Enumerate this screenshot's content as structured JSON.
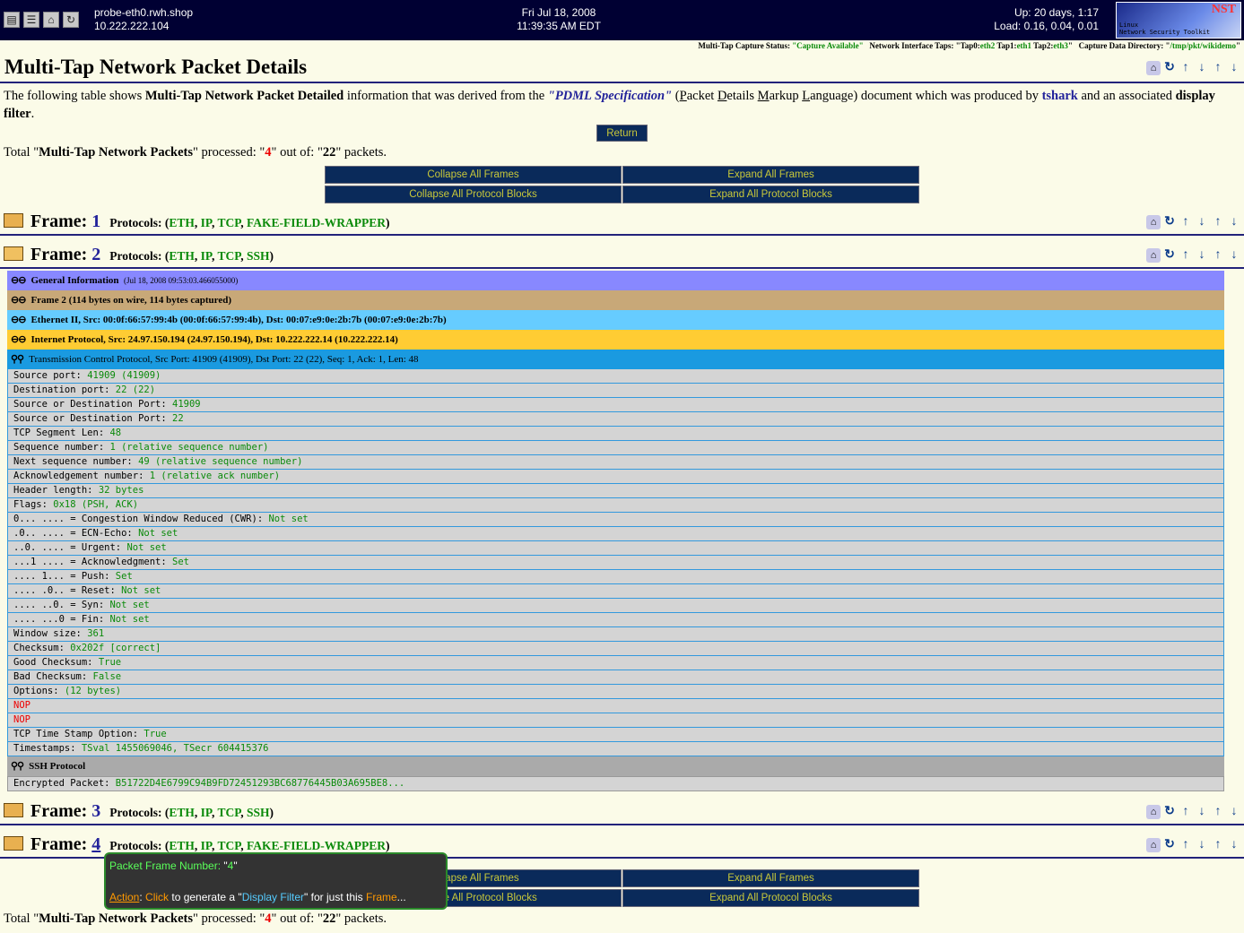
{
  "topbar": {
    "host": "probe-eth0.rwh.shop",
    "ip": "10.222.222.104",
    "date": "Fri Jul 18, 2008",
    "time": "11:39:35 AM EDT",
    "uptime": "Up: 20 days, 1:17",
    "load": "Load: 0.16, 0.04, 0.01",
    "logo": "NST",
    "logo_sub1": "Linux",
    "logo_sub2": "Network Security Toolkit"
  },
  "status": {
    "capture_label": "Multi-Tap Capture Status:",
    "capture_value": "\"Capture Available\"",
    "taps_label": "Network Interface Taps: \"Tap0:",
    "tap0": "eth2",
    "tap1_label": " Tap1:",
    "tap1": "eth1",
    "tap2_label": " Tap2:",
    "tap2": "eth3",
    "taps_end": "\"",
    "dir_label": "Capture Data Directory: \"",
    "dir": "/tmp/pkt/wikidemo",
    "dir_end": "\""
  },
  "page_title": "Multi-Tap Network Packet Details",
  "intro": {
    "p1": "The following table shows ",
    "b1": "Multi-Tap Network Packet Detailed",
    "p2": " information that was derived from the ",
    "pdml": "\"PDML Specification\"",
    "p3": " (",
    "P": "P",
    "acket": "acket ",
    "D": "D",
    "etails": "etails ",
    "M": "M",
    "arkup": "arkup ",
    "L": "L",
    "anguage": "anguage",
    "p4": ") document which was produced by ",
    "tshark": "tshark",
    "p5": " and an associated ",
    "b2": "display filter",
    "p6": "."
  },
  "return_label": "Return",
  "totals": {
    "pre": "Total \"",
    "b": "Multi-Tap Network Packets",
    "mid": "\" processed: \"",
    "n": "4",
    "mid2": "\" out of: \"",
    "total": "22",
    "end": "\" packets."
  },
  "buttons": {
    "collapse_frames": "Collapse All Frames",
    "expand_frames": "Expand All Frames",
    "collapse_blocks": "Collapse All Protocol Blocks",
    "expand_blocks": "Expand All Protocol Blocks"
  },
  "frames": [
    {
      "label": "Frame:",
      "num": "1",
      "proto_label": "Protocols:",
      "protos": [
        "ETH",
        "IP",
        "TCP",
        "FAKE-FIELD-WRAPPER"
      ]
    },
    {
      "label": "Frame:",
      "num": "2",
      "proto_label": "Protocols:",
      "protos": [
        "ETH",
        "IP",
        "TCP",
        "SSH"
      ]
    },
    {
      "label": "Frame:",
      "num": "3",
      "proto_label": "Protocols:",
      "protos": [
        "ETH",
        "IP",
        "TCP",
        "SSH"
      ]
    },
    {
      "label": "Frame:",
      "num": "4",
      "proto_label": "Protocols:",
      "protos": [
        "ETH",
        "IP",
        "TCP",
        "FAKE-FIELD-WRAPPER"
      ]
    }
  ],
  "blocks": {
    "general": "General Information",
    "general_ts": "(Jul 18, 2008 09:53:03.466055000)",
    "frame": "Frame 2 (114 bytes on wire, 114 bytes captured)",
    "eth": "Ethernet II, Src: 00:0f:66:57:99:4b (00:0f:66:57:99:4b), Dst: 00:07:e9:0e:2b:7b (00:07:e9:0e:2b:7b)",
    "ip": "Internet Protocol, Src: 24.97.150.194 (24.97.150.194), Dst: 10.222.222.14 (10.222.222.14)",
    "tcp": "Transmission Control Protocol, Src Port: 41909 (41909), Dst Port: 22 (22), Seq: 1, Ack: 1, Len: 48",
    "ssh": "SSH Protocol"
  },
  "tcp_fields": [
    [
      "Source port: ",
      "41909 (41909)"
    ],
    [
      "Destination port: ",
      "22 (22)"
    ],
    [
      "Source or Destination Port: ",
      "41909"
    ],
    [
      "Source or Destination Port: ",
      "22"
    ],
    [
      "TCP Segment Len: ",
      "48"
    ],
    [
      "Sequence number: ",
      "1 (relative sequence number)"
    ],
    [
      "Next sequence number: ",
      "49 (relative sequence number)"
    ],
    [
      "Acknowledgement number: ",
      "1 (relative ack number)"
    ],
    [
      "Header length: ",
      "32 bytes"
    ],
    [
      "Flags: ",
      "0x18 (PSH, ACK)"
    ],
    [
      "0... .... = Congestion Window Reduced (CWR): ",
      "Not set"
    ],
    [
      ".0.. .... = ECN-Echo: ",
      "Not set"
    ],
    [
      "..0. .... = Urgent: ",
      "Not set"
    ],
    [
      "...1 .... = Acknowledgment: ",
      "Set"
    ],
    [
      ".... 1... = Push: ",
      "Set"
    ],
    [
      ".... .0.. = Reset: ",
      "Not set"
    ],
    [
      ".... ..0. = Syn: ",
      "Not set"
    ],
    [
      ".... ...0 = Fin: ",
      "Not set"
    ],
    [
      "Window size: ",
      "361"
    ],
    [
      "Checksum: ",
      "0x202f [correct]"
    ],
    [
      "Good Checksum: ",
      "True"
    ],
    [
      "Bad Checksum: ",
      "False"
    ],
    [
      "Options: ",
      "(12 bytes)"
    ],
    [
      "",
      "NOP"
    ],
    [
      "",
      "NOP"
    ],
    [
      "TCP Time Stamp Option: ",
      "True"
    ],
    [
      "Timestamps: ",
      "TSval 1455069046, TSecr 604415376"
    ]
  ],
  "ssh_field": [
    "Encrypted Packet: ",
    "B51722D4E6799C94B9FD72451293BC68776445B03A695BE8..."
  ],
  "tooltip": {
    "t1": "Packet Frame Number: ",
    "q1": "\"",
    "num": "4",
    "q2": "\"",
    "action": "Action",
    "colon": ": ",
    "click": "Click",
    "t2": " to generate a \"",
    "df": "Display Filter",
    "t3": "\" for just this ",
    "frame": "Frame",
    "dots": "..."
  },
  "colors": {
    "general": "#8888ff",
    "frame": "#c8a878",
    "eth": "#66ccff",
    "ip": "#ffcc33",
    "tcp": "#1a9ae0",
    "ssh": "#aaaaaa"
  }
}
